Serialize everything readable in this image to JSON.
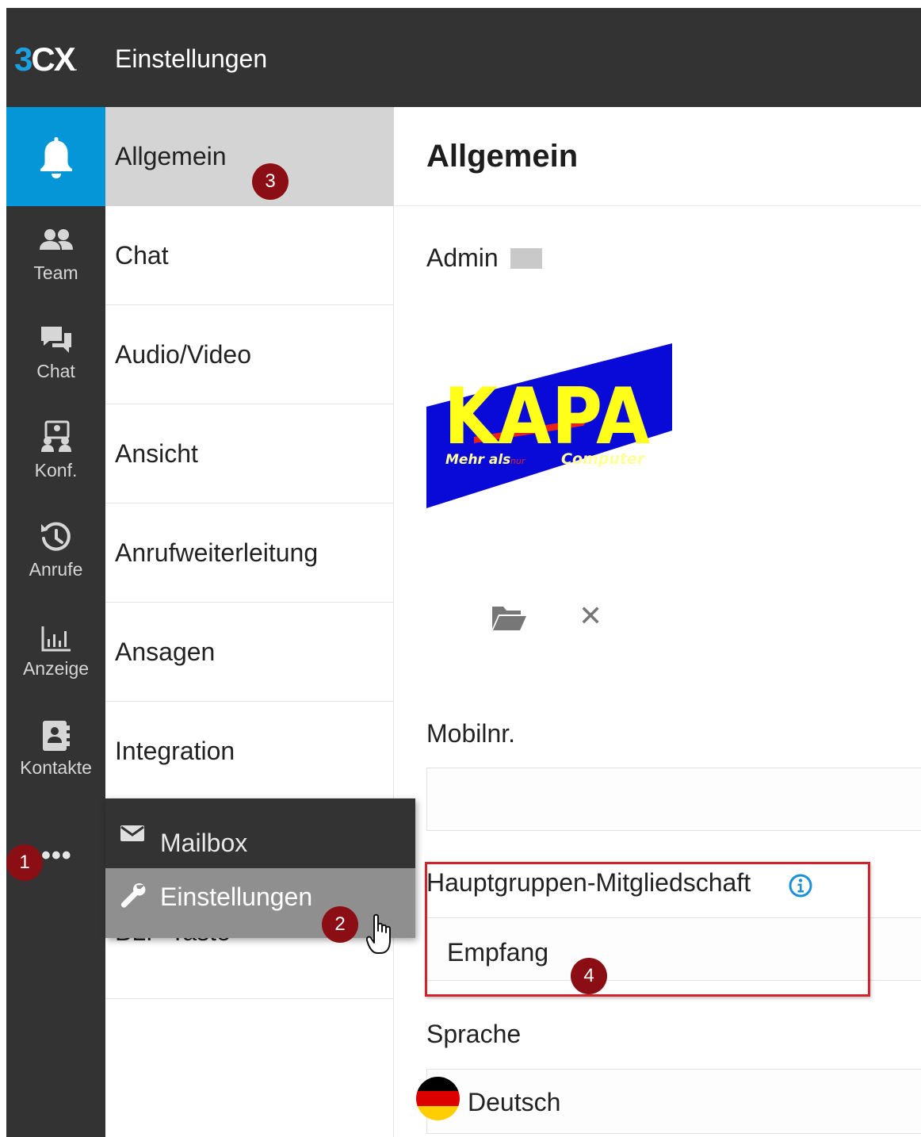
{
  "header": {
    "logo_number": "3",
    "logo_letters": "CX",
    "logo_dot": ".",
    "title": "Einstellungen"
  },
  "rail": {
    "items": [
      {
        "label": "",
        "icon": "bell-icon",
        "active": true
      },
      {
        "label": "Team",
        "icon": "team-icon"
      },
      {
        "label": "Chat",
        "icon": "chat-icon"
      },
      {
        "label": "Konf.",
        "icon": "conference-icon"
      },
      {
        "label": "Anrufe",
        "icon": "history-icon"
      },
      {
        "label": "Anzeige",
        "icon": "bar-chart-icon"
      },
      {
        "label": "Kontakte",
        "icon": "contacts-icon"
      }
    ],
    "more_label": "•••"
  },
  "subnav": {
    "items": [
      {
        "label": "Allgemein",
        "active": true
      },
      {
        "label": "Chat"
      },
      {
        "label": "Audio/Video"
      },
      {
        "label": "Ansicht"
      },
      {
        "label": "Anrufweiterleitung"
      },
      {
        "label": "Ansagen"
      },
      {
        "label": "Integration"
      },
      {
        "label": "BLF-Taste"
      }
    ]
  },
  "menu": {
    "items": [
      {
        "label": "Mailbox",
        "icon": "envelope-icon"
      },
      {
        "label": "Einstellungen",
        "icon": "wrench-icon",
        "hover": true
      }
    ]
  },
  "main": {
    "title": "Allgemein",
    "user_name": "Admin",
    "logo": {
      "text": "KAPA",
      "tagline_left": "Mehr als",
      "tagline_mid": "nur",
      "tagline_right": "Computer",
      "colors": {
        "blue": "#0a0ad8",
        "yellow": "#ffff1a",
        "red": "#e5231b"
      }
    },
    "clear_symbol": "✕",
    "mobile_label": "Mobilnr.",
    "mobile_value": "",
    "group_label": "Hauptgruppen-Mitgliedschaft",
    "group_value": "Empfang",
    "language_label": "Sprache",
    "language_value": "Deutsch",
    "flag_colors": [
      "#000000",
      "#dd0000",
      "#ffce00"
    ]
  },
  "badges": [
    "1",
    "2",
    "3",
    "4"
  ],
  "colors": {
    "topbar": "#333333",
    "accent": "#0596d7",
    "badge": "#8b0e14",
    "highlight": "#d2232a"
  }
}
